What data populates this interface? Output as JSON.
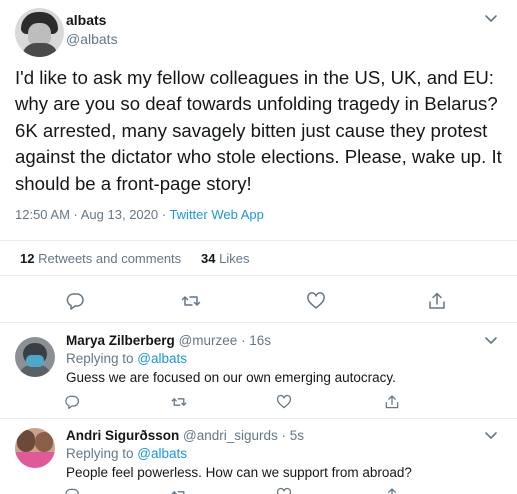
{
  "main_tweet": {
    "display_name": "albats",
    "handle": "@albats",
    "text": "I'd like to ask my fellow colleagues in the US, UK, and EU: why are you so deaf towards unfolding tragedy in Belarus? 6K arrested, many savagely bitten just cause they protest against the dictator who stole elections. Please, wake up. It should be a front-page story!",
    "timestamp": "12:50 AM · Aug 13, 2020 · ",
    "source_app": "Twitter Web App",
    "retweets_count": "12",
    "retweets_label": "Retweets and comments",
    "likes_count": "34",
    "likes_label": "Likes"
  },
  "replies": [
    {
      "display_name": "Marya Zilberberg",
      "handle_time": "@murzee · 16s",
      "replying_prefix": "Replying to ",
      "replying_to": "@albats",
      "text": "Guess we are focused on our own emerging autocracy."
    },
    {
      "display_name": "Andri Sigurðsson",
      "handle_time": "@andri_sigurds · 5s",
      "replying_prefix": "Replying to ",
      "replying_to": "@albats",
      "text": "People feel powerless. How can we support from abroad?"
    }
  ],
  "icons": {
    "reply": "speech-bubble-icon",
    "retweet": "retweet-icon",
    "like": "heart-icon",
    "share": "share-icon",
    "menu": "chevron-down-icon"
  },
  "colors": {
    "accent": "#1b95e0",
    "muted": "#657786",
    "text": "#14171a",
    "divider": "#e6ecf0"
  }
}
